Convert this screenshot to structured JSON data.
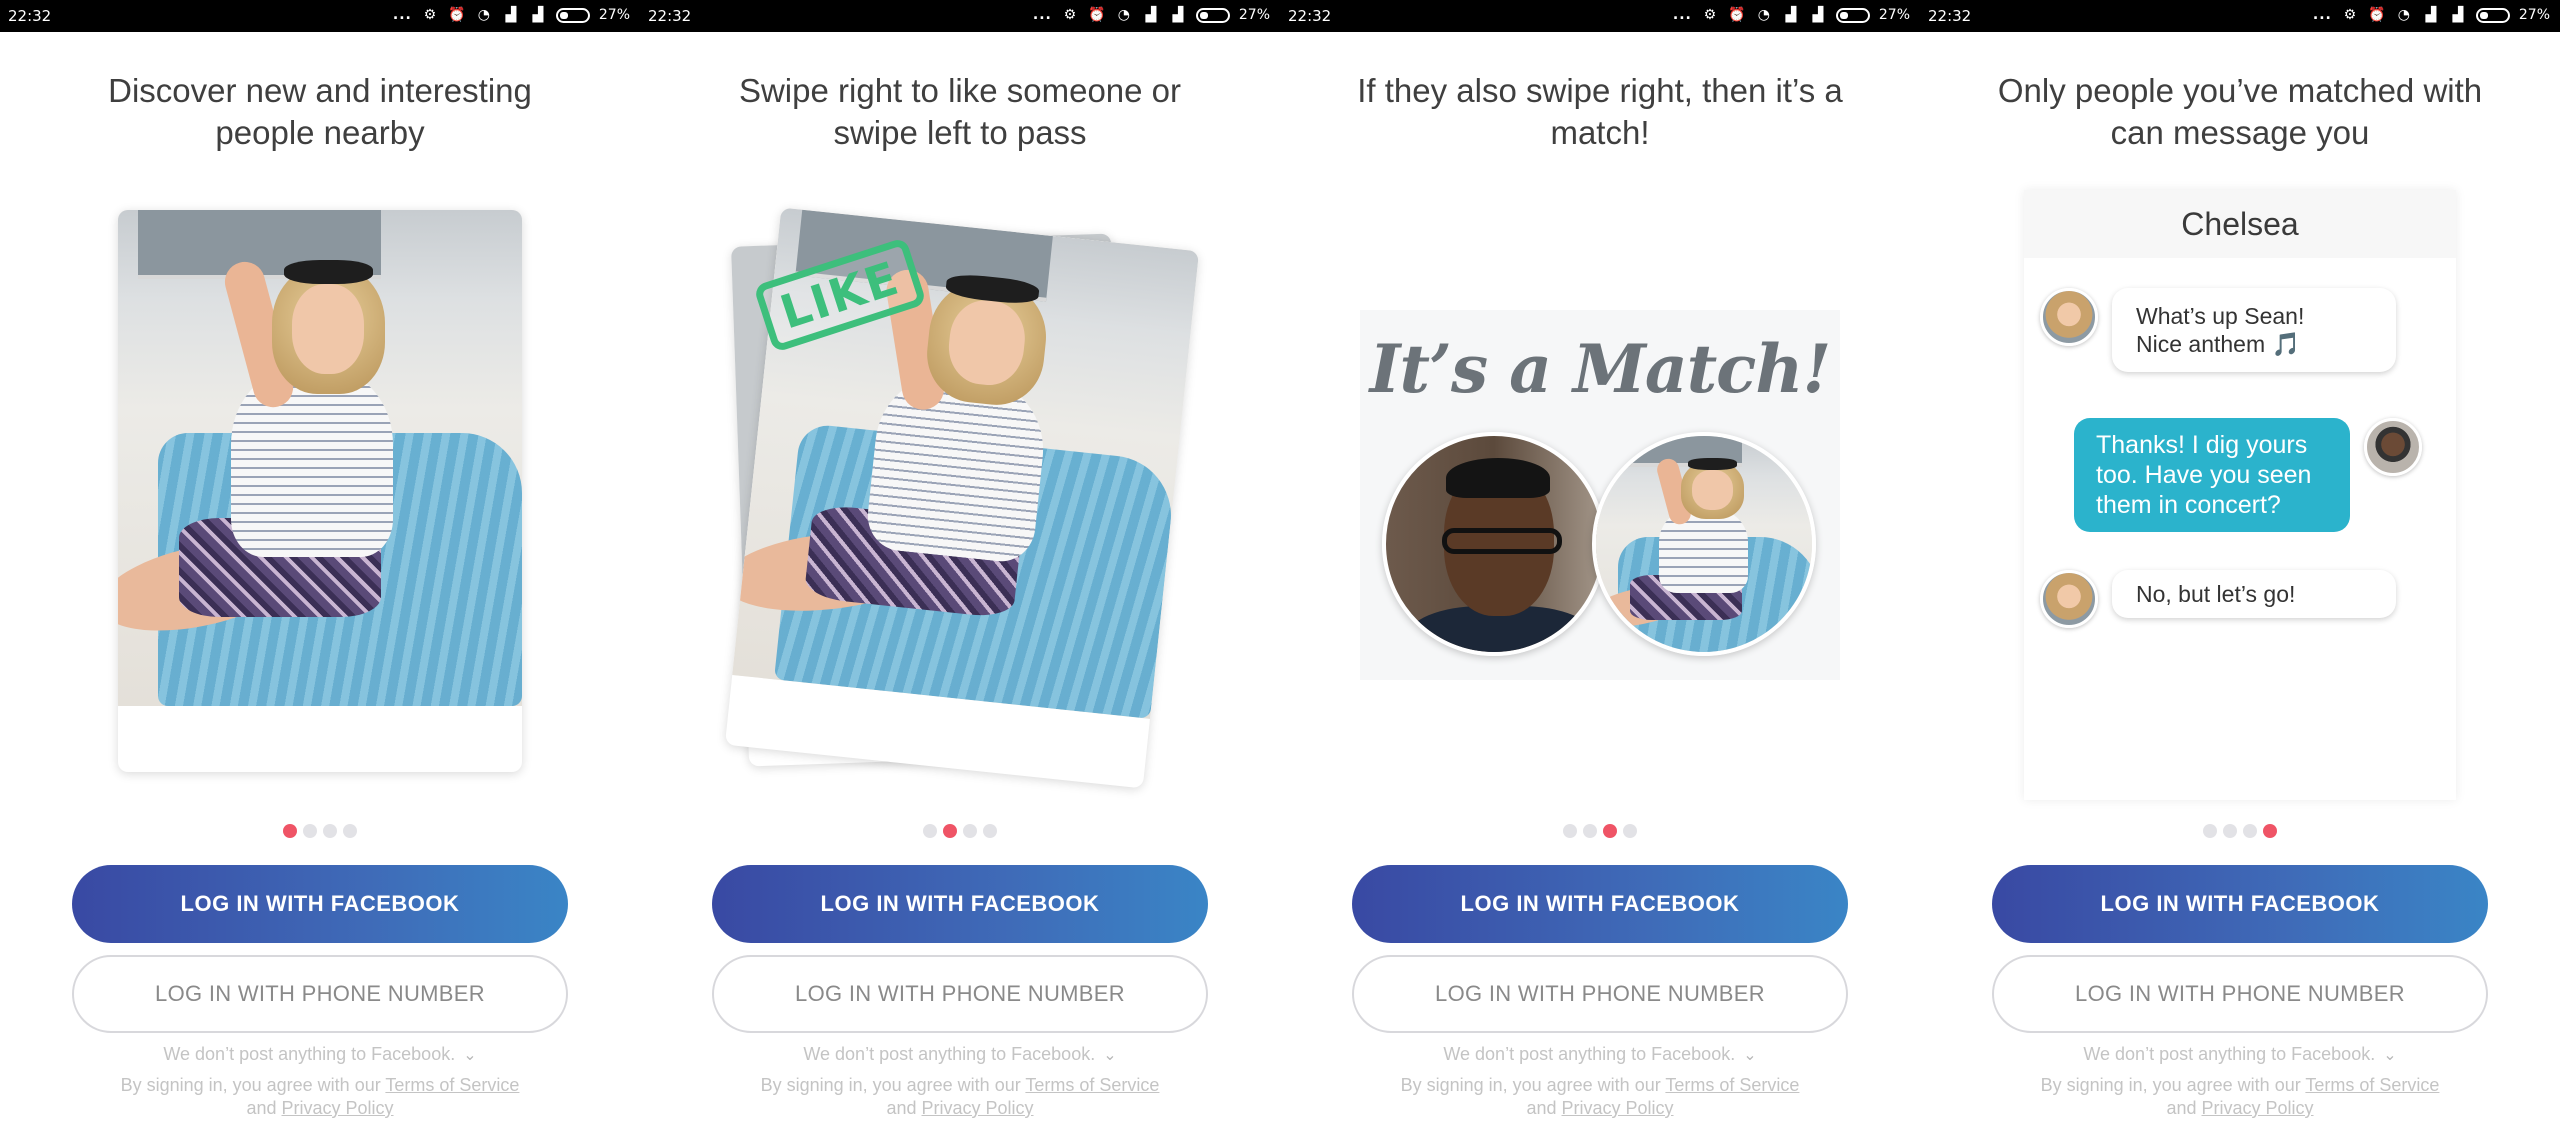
{
  "status_bar": {
    "time": "22:32",
    "dots": "...",
    "battery_pct": "27%",
    "icons": [
      "data-saver-icon",
      "alarm-icon",
      "wifi-icon",
      "signal-icon",
      "signal-icon",
      "battery-icon"
    ]
  },
  "screens": [
    {
      "heading": "Discover new and interesting people nearby",
      "active_dot": 0
    },
    {
      "heading": "Swipe right to like someone or swipe left to pass",
      "active_dot": 1,
      "stamp": "LIKE"
    },
    {
      "heading": "If they also swipe right, then it’s a match!",
      "active_dot": 2,
      "match_title": "It’s a Match!"
    },
    {
      "heading": "Only people you’ve matched with can message you",
      "active_dot": 3,
      "chat": {
        "name": "Chelsea",
        "messages": [
          {
            "from": "them",
            "text_line1": "What’s up Sean!",
            "text_line2": "Nice anthem",
            "emoji": "🎵"
          },
          {
            "from": "me",
            "text": "Thanks! I dig yours too. Have you seen them in concert?"
          },
          {
            "from": "them",
            "text": "No, but let’s go!"
          }
        ]
      }
    }
  ],
  "buttons": {
    "facebook": "LOG IN WITH FACEBOOK",
    "phone": "LOG IN WITH PHONE NUMBER"
  },
  "note": "We don’t post anything to Facebook.",
  "legal": {
    "prefix": "By signing in, you agree with our ",
    "terms": "Terms of Service",
    "and": " and ",
    "privacy": "Privacy Policy"
  },
  "colors": {
    "accent_dot": "#ef5466",
    "facebook_gradient_start": "#3949a3",
    "facebook_gradient_end": "#3a85c6",
    "like_green": "#3dbf7c",
    "chat_out": "#2bb3cc"
  }
}
